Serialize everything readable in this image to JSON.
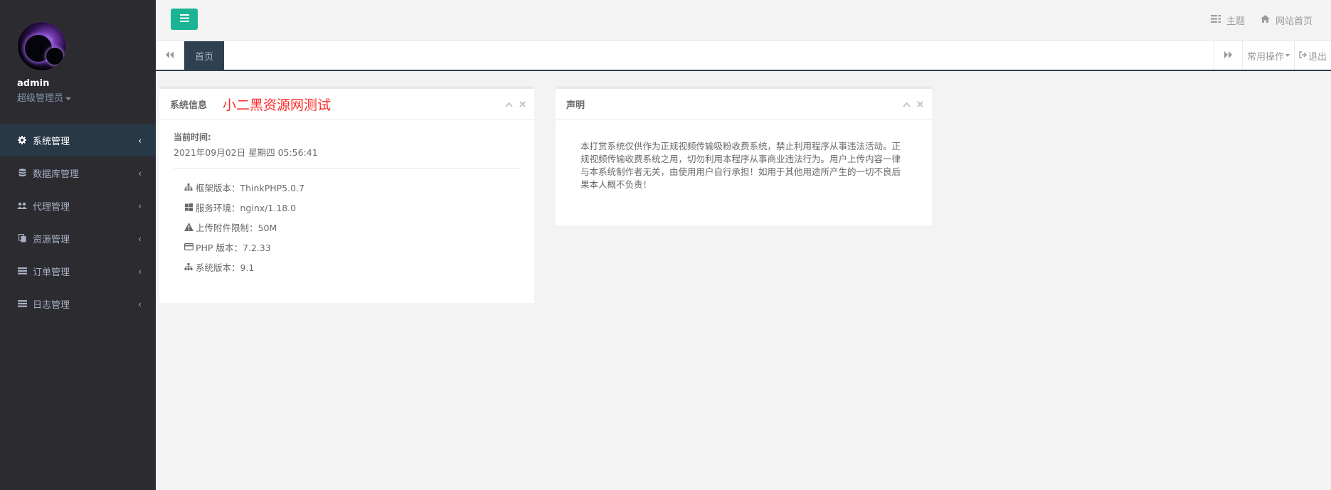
{
  "sidebar": {
    "username": "admin",
    "role": "超级管理员",
    "items": [
      {
        "label": "系统管理",
        "icon": "gear-icon",
        "active": true
      },
      {
        "label": "数据库管理",
        "icon": "database-icon",
        "active": false
      },
      {
        "label": "代理管理",
        "icon": "users-icon",
        "active": false
      },
      {
        "label": "资源管理",
        "icon": "files-icon",
        "active": false
      },
      {
        "label": "订单管理",
        "icon": "list-icon",
        "active": false
      },
      {
        "label": "日志管理",
        "icon": "list-icon",
        "active": false
      }
    ]
  },
  "topbar": {
    "theme_label": "主题",
    "home_label": "网站首页"
  },
  "tabs": {
    "home_tab": "首页",
    "common_ops": "常用操作",
    "logout": "退出"
  },
  "system_panel": {
    "title": "系统信息",
    "red_text": "小二黑资源网测试",
    "time_label": "当前时间:",
    "time_value": "2021年09月02日 星期四 05:56:41",
    "info": [
      {
        "label": "框架版本：ThinkPHP5.0.7",
        "icon": "sitemap-icon"
      },
      {
        "label": "服务环境：nginx/1.18.0",
        "icon": "windows-icon"
      },
      {
        "label": "上传附件限制：50M",
        "icon": "warning-icon"
      },
      {
        "label": "PHP 版本：7.2.33",
        "icon": "credit-card-icon"
      },
      {
        "label": "系统版本：9.1",
        "icon": "sitemap-icon"
      }
    ]
  },
  "statement_panel": {
    "title": "声明",
    "text": "本打赏系统仅供作为正规视频传输吸粉收费系统，禁止利用程序从事违法活动。正规视频传输收费系统之用，切勿利用本程序从事商业违法行为。用户上传内容一律与本系统制作者无关，由使用用户自行承担！如用于其他用途所产生的一切不良后果本人概不负责！"
  },
  "colors": {
    "sidebar_bg": "#2b2b30",
    "accent": "#1ab394",
    "red": "#ff2a2a"
  }
}
